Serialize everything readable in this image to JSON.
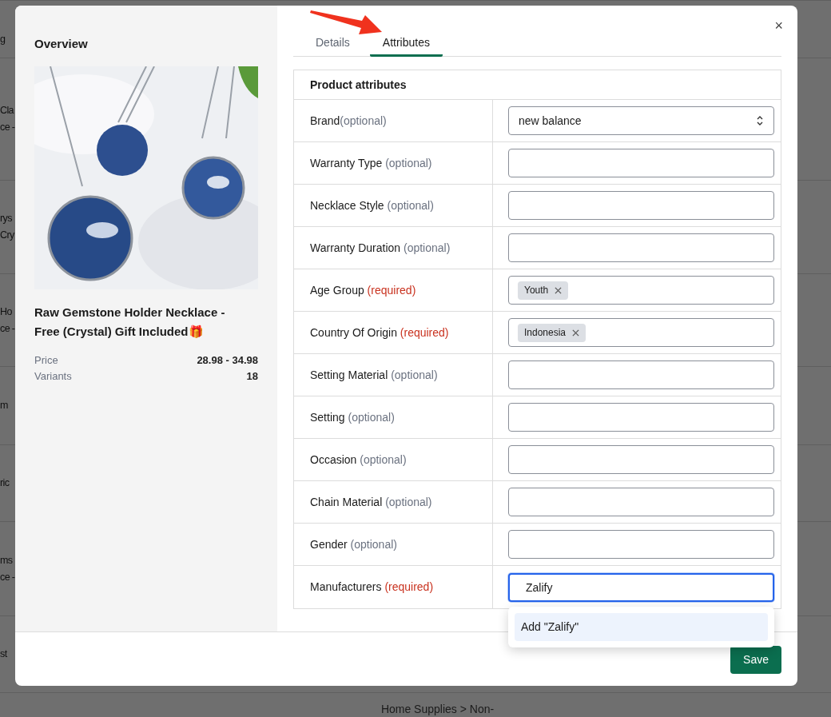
{
  "background_rows": [
    {
      "lines": [
        "g"
      ]
    },
    {
      "lines": [
        "Cla",
        "ce -"
      ]
    },
    {
      "lines": [
        "rys",
        "Cry"
      ]
    },
    {
      "lines": [
        "Ho",
        "ce -"
      ]
    },
    {
      "lines": [
        "m"
      ]
    },
    {
      "lines": [
        "ric"
      ]
    },
    {
      "lines": [
        "ms",
        "ce -"
      ]
    },
    {
      "lines": [
        "st"
      ]
    }
  ],
  "background_footer": "Home Supplies > Non-",
  "overview": {
    "title": "Overview",
    "product_name": "Raw Gemstone Holder Necklace - Free (Crystal) Gift Included🎁",
    "stats": [
      {
        "label": "Price",
        "value": "28.98 - 34.98"
      },
      {
        "label": "Variants",
        "value": "18"
      }
    ]
  },
  "close_button": "×",
  "tabs": [
    {
      "label": "Details",
      "selected": false
    },
    {
      "label": "Attributes",
      "selected": true
    }
  ],
  "attributes": {
    "title": "Product attributes",
    "rows": [
      {
        "label": "Brand",
        "note": "(optional)",
        "required": false,
        "note_attached": true,
        "kind": "select",
        "value": "new balance",
        "focused": false
      },
      {
        "label": "Warranty Type",
        "note": "(optional)",
        "required": false,
        "note_attached": false,
        "kind": "text",
        "focused": false
      },
      {
        "label": "Necklace Style",
        "note": "(optional)",
        "required": false,
        "note_attached": false,
        "kind": "text",
        "focused": false
      },
      {
        "label": "Warranty Duration",
        "note": "(optional)",
        "required": false,
        "note_attached": false,
        "kind": "text",
        "focused": false
      },
      {
        "label": "Age Group",
        "note": "(required)",
        "required": true,
        "note_attached": false,
        "kind": "tags",
        "tags": [
          "Youth"
        ],
        "focused": false
      },
      {
        "label": "Country Of Origin",
        "note": "(required)",
        "required": true,
        "note_attached": false,
        "kind": "tags",
        "tags": [
          "Indonesia"
        ],
        "focused": false
      },
      {
        "label": "Setting Material",
        "note": "(optional)",
        "required": false,
        "note_attached": false,
        "kind": "text",
        "focused": false
      },
      {
        "label": "Setting",
        "note": "(optional)",
        "required": false,
        "note_attached": false,
        "kind": "text",
        "focused": false
      },
      {
        "label": "Occasion",
        "note": "(optional)",
        "required": false,
        "note_attached": false,
        "kind": "text",
        "focused": false
      },
      {
        "label": "Chain Material",
        "note": "(optional)",
        "required": false,
        "note_attached": false,
        "kind": "text",
        "focused": false
      },
      {
        "label": "Gender",
        "note": "(optional)",
        "required": false,
        "note_attached": false,
        "kind": "text",
        "focused": false
      },
      {
        "label": "Manufacturers",
        "note": "(required)",
        "required": true,
        "note_attached": false,
        "kind": "text",
        "value": "Zalify",
        "focused": true
      }
    ]
  },
  "dropdown": {
    "options": [
      {
        "label": "Add \"Zalify\"",
        "selected": true
      }
    ]
  },
  "save_button": "Save"
}
